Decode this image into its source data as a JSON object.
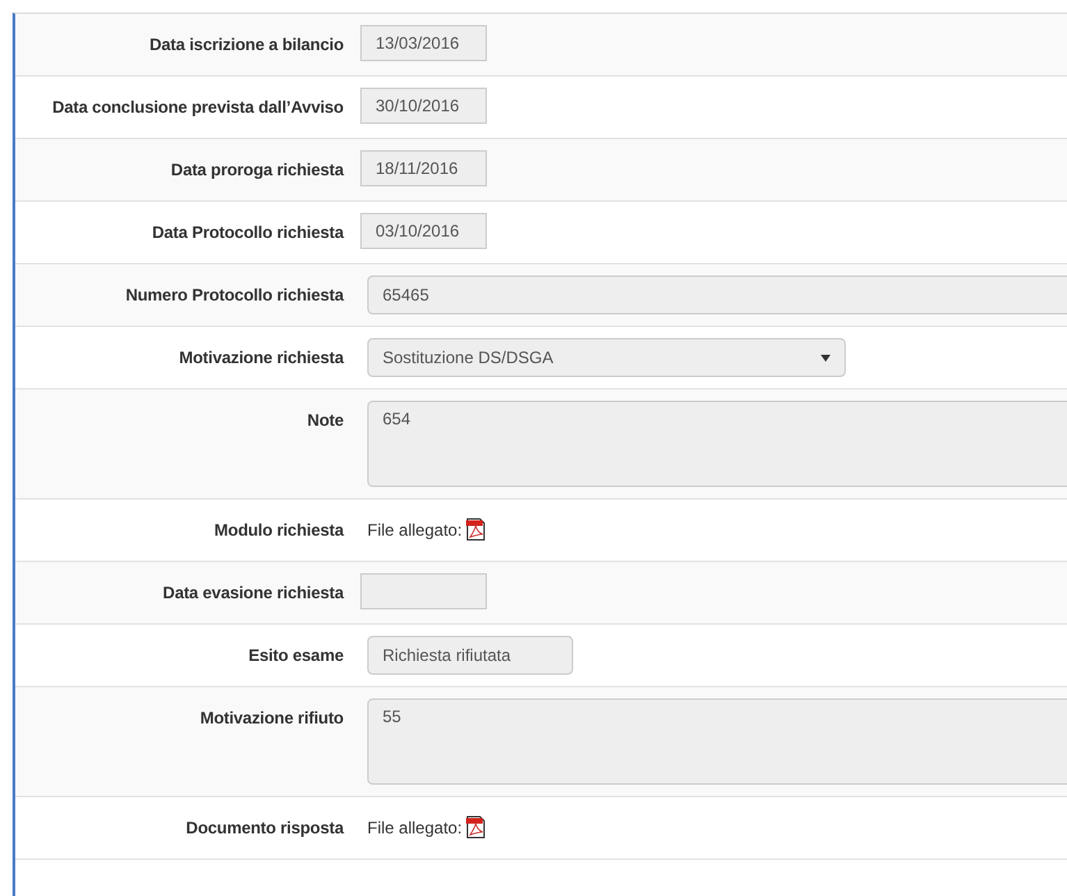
{
  "form": {
    "rows": [
      {
        "label": "Data iscrizione a bilancio",
        "kind": "date",
        "value": "13/03/2016"
      },
      {
        "label": "Data conclusione prevista dall’Avviso",
        "kind": "date",
        "value": "30/10/2016"
      },
      {
        "label": "Data proroga richiesta",
        "kind": "date",
        "value": "18/11/2016"
      },
      {
        "label": "Data Protocollo richiesta",
        "kind": "date",
        "value": "03/10/2016"
      },
      {
        "label": "Numero Protocollo richiesta",
        "kind": "text",
        "value": "65465"
      },
      {
        "label": "Motivazione richiesta",
        "kind": "select",
        "value": "Sostituzione DS/DSGA"
      },
      {
        "label": "Note",
        "kind": "textarea",
        "value": "654"
      },
      {
        "label": "Modulo richiesta",
        "kind": "file",
        "value": "File allegato:"
      },
      {
        "label": "Data evasione richiesta",
        "kind": "date"
      },
      {
        "label": "Esito esame",
        "kind": "short",
        "value": "Richiesta rifiutata"
      },
      {
        "label": "Motivazione rifiuto",
        "kind": "textarea",
        "value": "55"
      },
      {
        "label": "Documento risposta",
        "kind": "file",
        "value": "File allegato:"
      }
    ]
  }
}
